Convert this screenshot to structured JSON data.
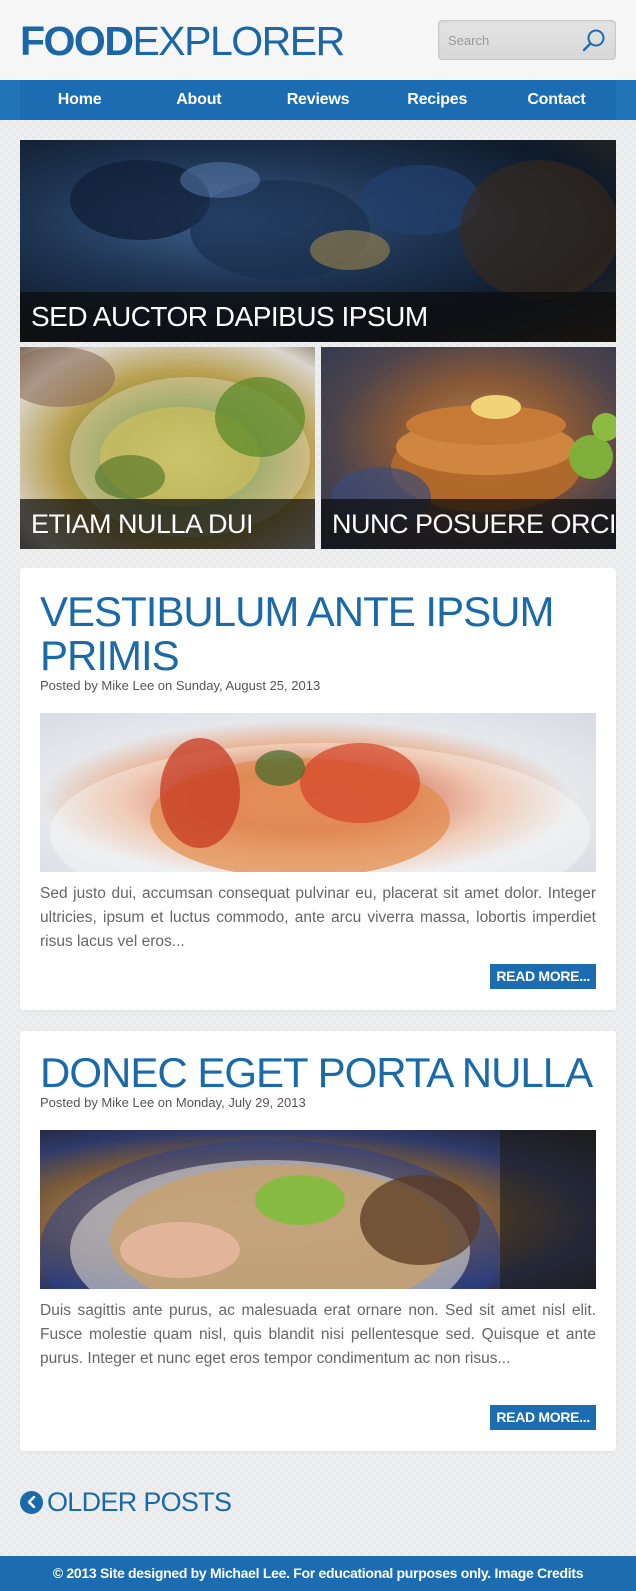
{
  "header": {
    "logo_bold": "FOOD",
    "logo_light": "EXPLORER",
    "search_placeholder": "Search"
  },
  "nav": {
    "items": [
      {
        "label": "Home"
      },
      {
        "label": "About"
      },
      {
        "label": "Reviews"
      },
      {
        "label": "Recipes"
      },
      {
        "label": "Contact"
      }
    ]
  },
  "featured": [
    {
      "caption": "SED AUCTOR DAPIBUS IPSUM"
    },
    {
      "caption": "ETIAM NULLA DUI"
    },
    {
      "caption": "NUNC POSUERE ORCI"
    }
  ],
  "posts": [
    {
      "title": "VESTIBULUM ANTE IPSUM PRIMIS",
      "meta": "Posted by Mike Lee on Sunday, August 25, 2013",
      "excerpt": "Sed justo dui, accumsan consequat pulvinar eu, placerat sit amet dolor. Integer ultricies, ipsum et luctus commodo, ante arcu viverra massa, lobortis imperdiet risus lacus vel eros...",
      "read_more": "READ MORE..."
    },
    {
      "title": "DONEC EGET PORTA NULLA",
      "meta": "Posted by Mike Lee on Monday, July 29, 2013",
      "excerpt": "Duis sagittis ante purus, ac malesuada erat ornare non. Sed sit amet nisl elit. Fusce molestie quam nisl, quis blandit nisi pellentesque sed. Quisque et ante purus. Integer et nunc eget eros tempor condimentum ac non risus...",
      "read_more": "READ MORE..."
    }
  ],
  "pagination": {
    "older_label": "OLDER POSTS"
  },
  "footer": {
    "text": "© 2013 Site designed by Michael Lee. For educational purposes only.",
    "credits_link": "Image Credits"
  },
  "colors": {
    "brand_blue": "#1b6cb0",
    "title_blue": "#1a6aaa",
    "background": "#e9eaeb"
  }
}
